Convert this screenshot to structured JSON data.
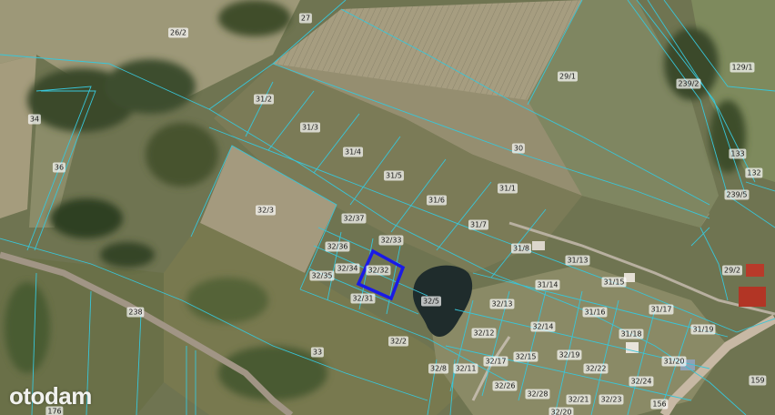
{
  "map": {
    "selected_parcel": "32/32",
    "colors": {
      "parcel_line": "#38c6d9",
      "selected_outline": "#1a1ae6",
      "field_dark": "#6f7451",
      "field_light": "#a69d80",
      "forest": "#3b4a2c",
      "pond": "#1f2c2c",
      "road": "#9a8f83"
    },
    "parcels": [
      {
        "id": "p-27",
        "label": "27"
      },
      {
        "id": "p-26-2",
        "label": "26/2"
      },
      {
        "id": "p-129-1",
        "label": "129/1"
      },
      {
        "id": "p-29-1",
        "label": "29/1"
      },
      {
        "id": "p-239-2",
        "label": "239/2"
      },
      {
        "id": "p-31-2",
        "label": "31/2"
      },
      {
        "id": "p-34",
        "label": "34"
      },
      {
        "id": "p-31-3",
        "label": "31/3"
      },
      {
        "id": "p-30",
        "label": "30"
      },
      {
        "id": "p-31-4",
        "label": "31/4"
      },
      {
        "id": "p-133",
        "label": "133"
      },
      {
        "id": "p-36",
        "label": "36"
      },
      {
        "id": "p-132",
        "label": "132"
      },
      {
        "id": "p-31-5",
        "label": "31/5"
      },
      {
        "id": "p-31-1",
        "label": "31/1"
      },
      {
        "id": "p-239-5",
        "label": "239/5"
      },
      {
        "id": "p-31-6",
        "label": "31/6"
      },
      {
        "id": "p-32-3",
        "label": "32/3"
      },
      {
        "id": "p-32-37",
        "label": "32/37"
      },
      {
        "id": "p-31-7",
        "label": "31/7"
      },
      {
        "id": "p-32-33",
        "label": "32/33"
      },
      {
        "id": "p-32-36",
        "label": "32/36"
      },
      {
        "id": "p-31-8",
        "label": "31/8"
      },
      {
        "id": "p-31-13",
        "label": "31/13"
      },
      {
        "id": "p-32-34",
        "label": "32/34"
      },
      {
        "id": "p-32-32",
        "label": "32/32"
      },
      {
        "id": "p-29-2",
        "label": "29/2"
      },
      {
        "id": "p-32-35",
        "label": "32/35"
      },
      {
        "id": "p-31-15",
        "label": "31/15"
      },
      {
        "id": "p-31-14",
        "label": "31/14"
      },
      {
        "id": "p-32-31",
        "label": "32/31"
      },
      {
        "id": "p-32-5",
        "label": "32/5"
      },
      {
        "id": "p-32-13",
        "label": "32/13"
      },
      {
        "id": "p-238",
        "label": "238"
      },
      {
        "id": "p-31-16",
        "label": "31/16"
      },
      {
        "id": "p-31-17",
        "label": "31/17"
      },
      {
        "id": "p-32-14",
        "label": "32/14"
      },
      {
        "id": "p-31-19",
        "label": "31/19"
      },
      {
        "id": "p-32-12",
        "label": "32/12"
      },
      {
        "id": "p-31-18",
        "label": "31/18"
      },
      {
        "id": "p-32-2",
        "label": "32/2"
      },
      {
        "id": "p-33",
        "label": "33"
      },
      {
        "id": "p-32-19",
        "label": "32/19"
      },
      {
        "id": "p-32-15",
        "label": "32/15"
      },
      {
        "id": "p-32-17",
        "label": "32/17"
      },
      {
        "id": "p-31-20",
        "label": "31/20"
      },
      {
        "id": "p-32-8",
        "label": "32/8"
      },
      {
        "id": "p-32-11",
        "label": "32/11"
      },
      {
        "id": "p-32-22",
        "label": "32/22"
      },
      {
        "id": "p-159",
        "label": "159"
      },
      {
        "id": "p-32-24",
        "label": "32/24"
      },
      {
        "id": "p-32-26",
        "label": "32/26"
      },
      {
        "id": "p-32-28",
        "label": "32/28"
      },
      {
        "id": "p-32-21",
        "label": "32/21"
      },
      {
        "id": "p-32-23",
        "label": "32/23"
      },
      {
        "id": "p-156",
        "label": "156"
      },
      {
        "id": "p-176",
        "label": "176"
      },
      {
        "id": "p-32-20",
        "label": "32/20"
      }
    ]
  },
  "watermark": {
    "text": "otodam"
  }
}
